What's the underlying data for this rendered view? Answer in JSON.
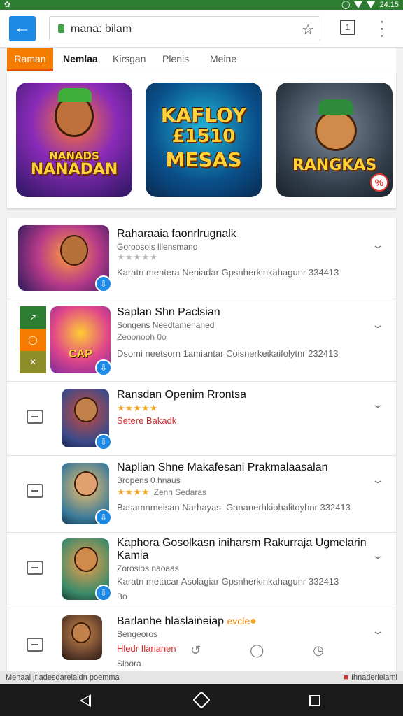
{
  "colors": {
    "status_bar": "#2e7d32",
    "accent_blue": "#1e88e5",
    "active_tab": "#f57c00",
    "star": "#f5a623",
    "sale_red": "#d32f2f"
  },
  "status_bar": {
    "right_text": "24:15"
  },
  "browser": {
    "back_icon": "arrow-left-icon",
    "url": "mana: bilam",
    "bookmark_icon": "star-outline-icon",
    "tabs_label": "1",
    "menu_icon": "vertical-dots-icon"
  },
  "categories": [
    {
      "label": "Raman",
      "active": true
    },
    {
      "label": "Nemlaa",
      "active": false
    },
    {
      "label": "Kirsgan",
      "active": false
    },
    {
      "label": "Plenis",
      "active": false
    },
    {
      "label": "Meine",
      "active": false
    }
  ],
  "featured": [
    {
      "title": "NANADAN",
      "subtitle": "NANADS"
    },
    {
      "title": "KAFLOY",
      "subtitle": "MESAS",
      "extra": "£1510"
    },
    {
      "title": "RANGKAS",
      "badge": "%"
    }
  ],
  "list": [
    {
      "title": "Raharaaia faonrlrugnalk",
      "subtitle": "Goroosois lllensmano",
      "rating": "★★★★★",
      "desc": "Karatn mentera Neniadar  Gpsnherkinkahagunr 334413"
    },
    {
      "title": "Saplan Shn Paclsian",
      "subtitle": "Songens Needtamenaned",
      "rating_note": "Zeoonooh 0o",
      "desc": "Dsomi neetsorn 1amiantar  Coisnerkeikaifolytnr 232413"
    },
    {
      "title": "Ransdan Openim Rrontsa",
      "rating": "★★★★★",
      "sale_text": "Setere Bakadk"
    },
    {
      "title": "Naplian Shne Makafesani Prakmalaasalan",
      "subtitle": "Bropens 0 hnaus",
      "rating": "★★★★",
      "rating_note": "Zenn Sedaras",
      "desc": "Basamnmeisan Narhayas.  Gananerhkiohalitoyhnr 332413"
    },
    {
      "title": "Kaphora Gosolkasn iniharsm Rakurraja Ugmelarin",
      "title_line2": "Kamia",
      "subtitle": "Zoroslos naoaas",
      "desc": "Karatn metacar Asolagiar  Gpsnherkinkahagunr 332413",
      "extra": "Bo"
    },
    {
      "title": "Barlanhe hlaslaineiap",
      "title_tag": "evcle",
      "subtitle": "Bengeoros",
      "sale_text": "Hledr Ilarianen",
      "extra": "Sloora"
    }
  ],
  "bottom_strip": {
    "left": "Menaal jriadesdarelaidn poemma",
    "right": "Ihnaderielami"
  }
}
